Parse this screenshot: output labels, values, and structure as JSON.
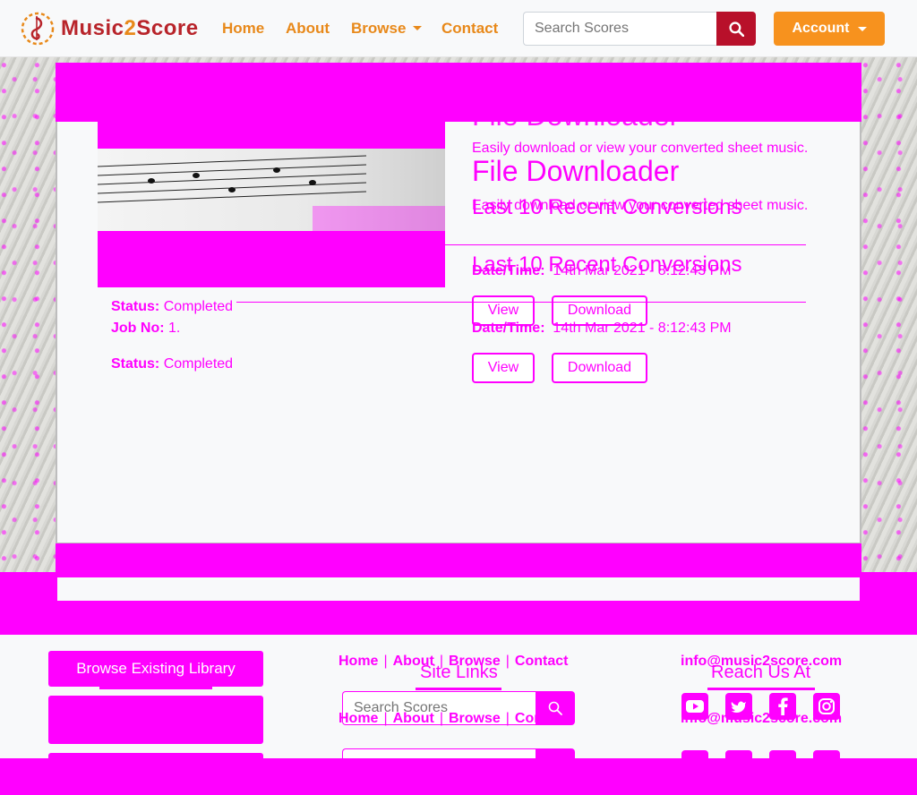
{
  "brand": {
    "name_part1": "Music",
    "name_part2": "2",
    "name_part3": "Score"
  },
  "nav": {
    "home": "Home",
    "about": "About",
    "browse": "Browse",
    "contact": "Contact",
    "search_placeholder": "Search Scores",
    "account": "Account"
  },
  "downloader": {
    "title": "File Downloader",
    "subtitle": "Easily download or view your converted sheet music.",
    "recent_heading": "Last 10 Recent Conversions",
    "status_label": "Status",
    "status_value": "Completed",
    "job_label": "Job No",
    "job_value": "1.",
    "datetime_label": "Date/Time",
    "datetime_value": "14th Mar 2021 - 8:12:43 PM",
    "view_label": "View",
    "download_label": "Download"
  },
  "footer": {
    "browse_library": "Browse Existing Library",
    "site_links_title": "Site Links",
    "reach_us_title": "Reach Us At",
    "links": [
      "Home",
      "About",
      "Browse",
      "Contact"
    ],
    "search_placeholder": "Search Scores",
    "email": "info@music2score.com",
    "social_icons": [
      "youtube-icon",
      "twitter-icon",
      "facebook-icon",
      "instagram-icon"
    ]
  },
  "colors": {
    "brand_red": "#b8242a",
    "brand_orange": "#e8891a",
    "account_orange": "#f7921e",
    "search_button": "#b8102a",
    "magenta": "#ff00ff"
  }
}
